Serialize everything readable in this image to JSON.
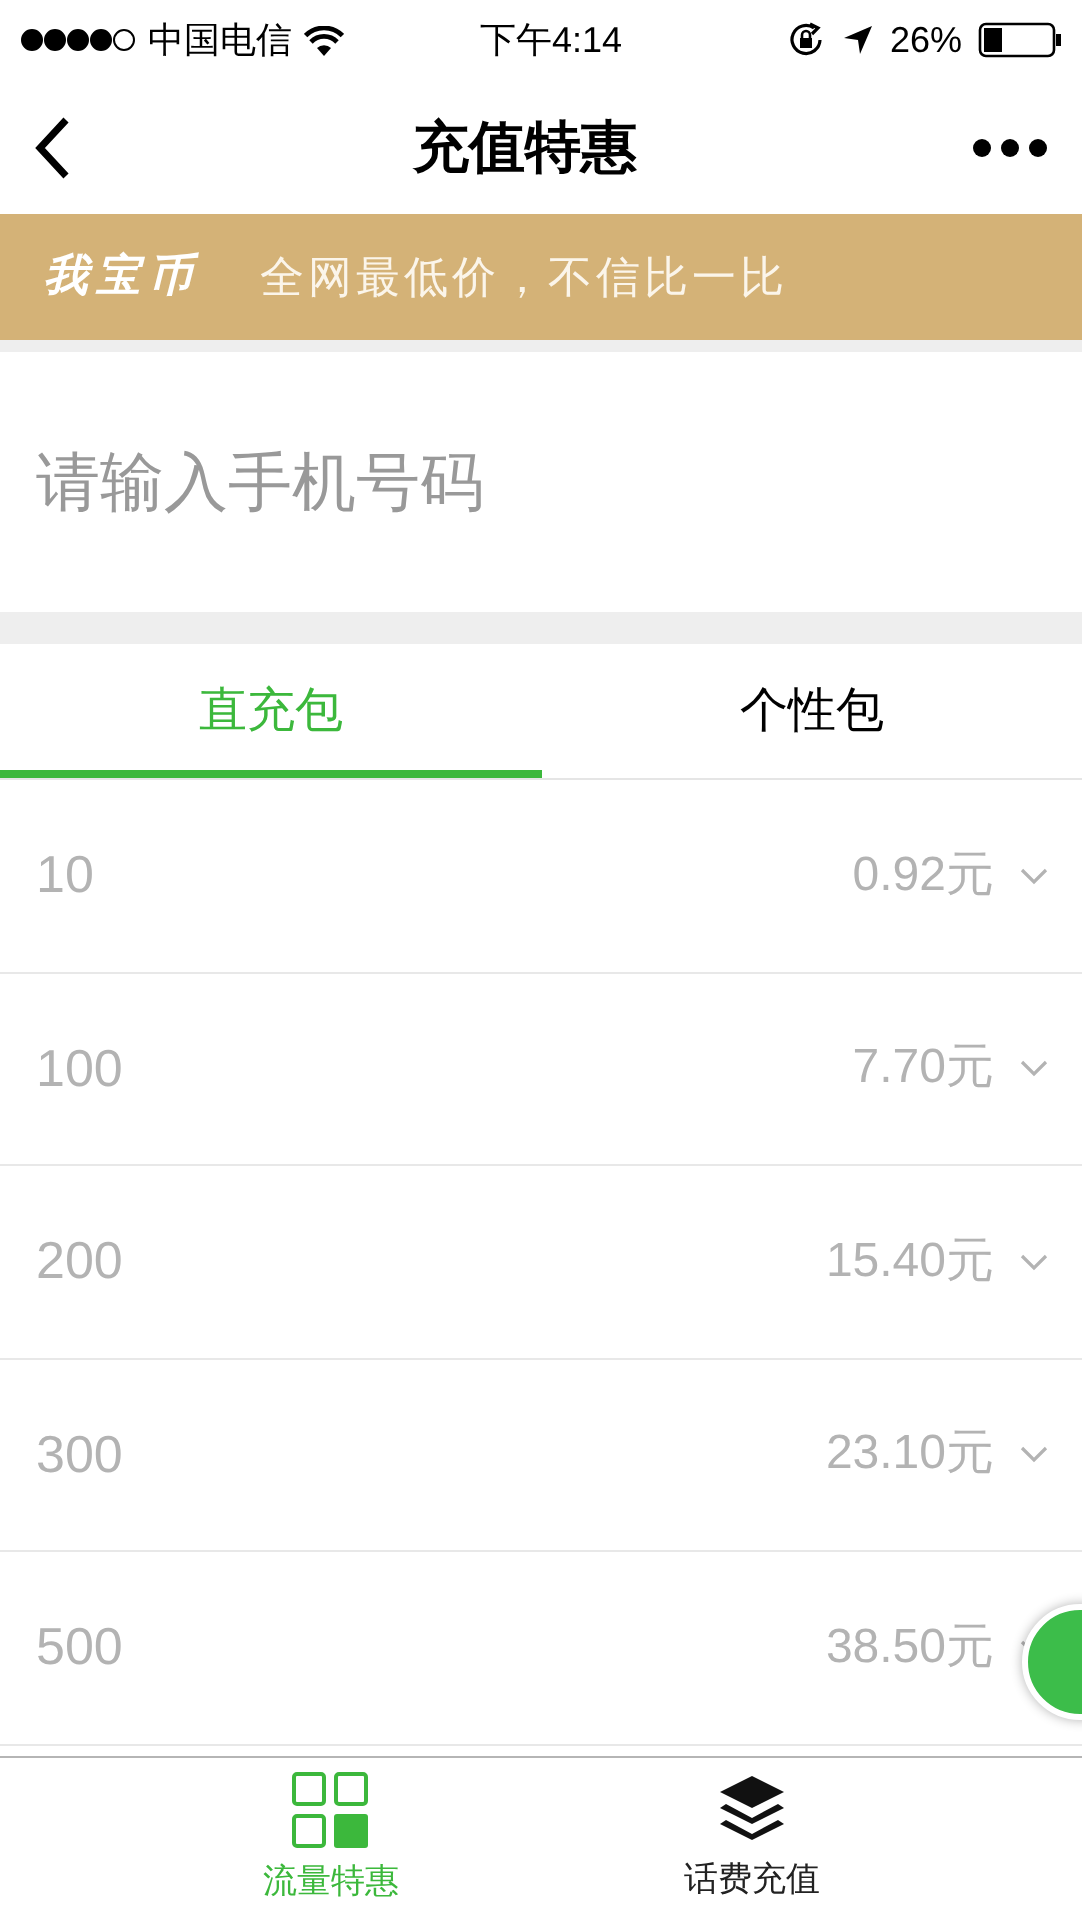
{
  "status_bar": {
    "carrier": "中国电信",
    "time": "下午4:14",
    "battery": "26%"
  },
  "nav": {
    "title": "充值特惠"
  },
  "banner": {
    "logo": "我宝币",
    "slogan": "全网最低价，不信比一比"
  },
  "phone_field": {
    "placeholder": "请输入手机号码"
  },
  "tabs": [
    {
      "label": "直充包",
      "selected": true
    },
    {
      "label": "个性包",
      "selected": false
    }
  ],
  "packages": [
    {
      "amount": "10",
      "price": "0.92元"
    },
    {
      "amount": "100",
      "price": "7.70元"
    },
    {
      "amount": "200",
      "price": "15.40元"
    },
    {
      "amount": "300",
      "price": "23.10元"
    },
    {
      "amount": "500",
      "price": "38.50元"
    }
  ],
  "tab_bar": [
    {
      "label": "流量特惠",
      "kind": "grid",
      "selected": true
    },
    {
      "label": "话费充值",
      "kind": "layers",
      "selected": false
    }
  ]
}
